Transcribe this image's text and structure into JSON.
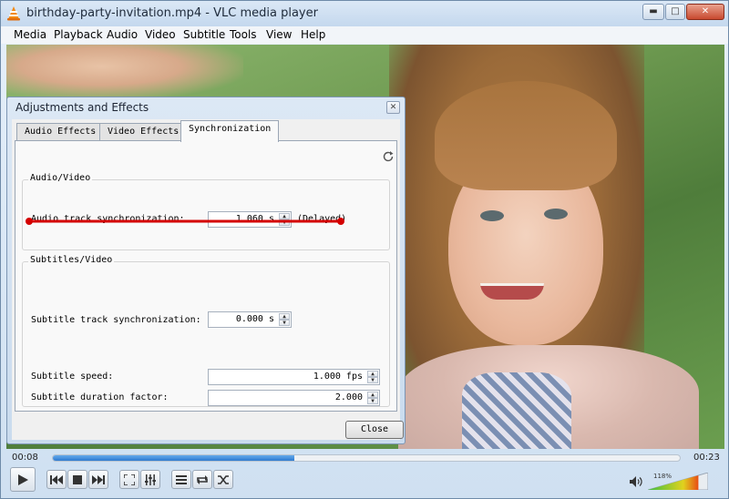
{
  "window": {
    "title": "birthday-party-invitation.mp4 - VLC media player",
    "buttons": {
      "minimize": "▬",
      "maximize": "□",
      "close": "✕"
    }
  },
  "menu": [
    "Media",
    "Playback",
    "Audio",
    "Video",
    "Subtitle",
    "Tools",
    "View",
    "Help"
  ],
  "dialog": {
    "title": "Adjustments and Effects",
    "close_glyph": "✕",
    "tabs": [
      "Audio Effects",
      "Video Effects",
      "Synchronization"
    ],
    "active_tab": "Synchronization",
    "audio_video": {
      "group_label": "Audio/Video",
      "audio_sync_label": "Audio track synchronization:",
      "audio_sync_value": "1.060 s",
      "audio_sync_note": "(Delayed)"
    },
    "subtitles_video": {
      "group_label": "Subtitles/Video",
      "subtitle_sync_label": "Subtitle track synchronization:",
      "subtitle_sync_value": "0.000 s",
      "subtitle_speed_label": "Subtitle speed:",
      "subtitle_speed_value": "1.000 fps",
      "subtitle_duration_label": "Subtitle duration factor:",
      "subtitle_duration_value": "2.000"
    },
    "close_button": "Close"
  },
  "player": {
    "elapsed": "00:08",
    "total": "00:23",
    "progress_fraction": 0.385,
    "volume_label": "118%",
    "volume_fraction": 0.84,
    "accent": "#2f7bd1",
    "annotation_color": "#d40000"
  }
}
